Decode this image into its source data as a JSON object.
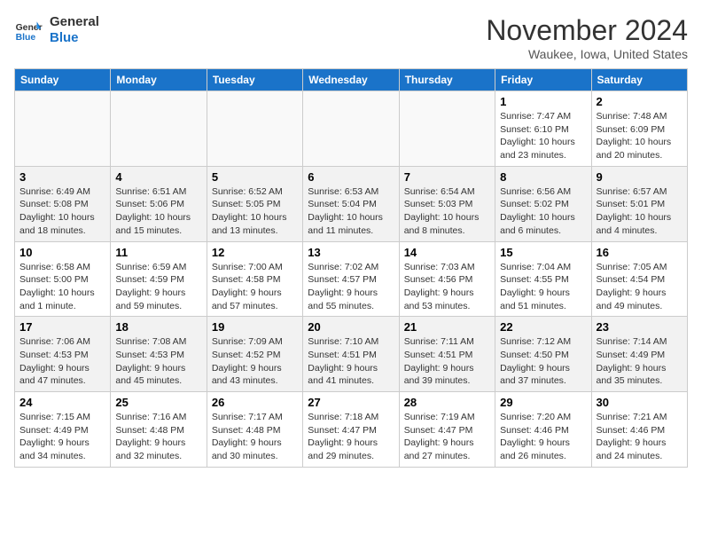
{
  "logo": {
    "line1": "General",
    "line2": "Blue"
  },
  "title": "November 2024",
  "location": "Waukee, Iowa, United States",
  "days_of_week": [
    "Sunday",
    "Monday",
    "Tuesday",
    "Wednesday",
    "Thursday",
    "Friday",
    "Saturday"
  ],
  "weeks": [
    [
      {
        "day": "",
        "info": ""
      },
      {
        "day": "",
        "info": ""
      },
      {
        "day": "",
        "info": ""
      },
      {
        "day": "",
        "info": ""
      },
      {
        "day": "",
        "info": ""
      },
      {
        "day": "1",
        "info": "Sunrise: 7:47 AM\nSunset: 6:10 PM\nDaylight: 10 hours and 23 minutes."
      },
      {
        "day": "2",
        "info": "Sunrise: 7:48 AM\nSunset: 6:09 PM\nDaylight: 10 hours and 20 minutes."
      }
    ],
    [
      {
        "day": "3",
        "info": "Sunrise: 6:49 AM\nSunset: 5:08 PM\nDaylight: 10 hours and 18 minutes."
      },
      {
        "day": "4",
        "info": "Sunrise: 6:51 AM\nSunset: 5:06 PM\nDaylight: 10 hours and 15 minutes."
      },
      {
        "day": "5",
        "info": "Sunrise: 6:52 AM\nSunset: 5:05 PM\nDaylight: 10 hours and 13 minutes."
      },
      {
        "day": "6",
        "info": "Sunrise: 6:53 AM\nSunset: 5:04 PM\nDaylight: 10 hours and 11 minutes."
      },
      {
        "day": "7",
        "info": "Sunrise: 6:54 AM\nSunset: 5:03 PM\nDaylight: 10 hours and 8 minutes."
      },
      {
        "day": "8",
        "info": "Sunrise: 6:56 AM\nSunset: 5:02 PM\nDaylight: 10 hours and 6 minutes."
      },
      {
        "day": "9",
        "info": "Sunrise: 6:57 AM\nSunset: 5:01 PM\nDaylight: 10 hours and 4 minutes."
      }
    ],
    [
      {
        "day": "10",
        "info": "Sunrise: 6:58 AM\nSunset: 5:00 PM\nDaylight: 10 hours and 1 minute."
      },
      {
        "day": "11",
        "info": "Sunrise: 6:59 AM\nSunset: 4:59 PM\nDaylight: 9 hours and 59 minutes."
      },
      {
        "day": "12",
        "info": "Sunrise: 7:00 AM\nSunset: 4:58 PM\nDaylight: 9 hours and 57 minutes."
      },
      {
        "day": "13",
        "info": "Sunrise: 7:02 AM\nSunset: 4:57 PM\nDaylight: 9 hours and 55 minutes."
      },
      {
        "day": "14",
        "info": "Sunrise: 7:03 AM\nSunset: 4:56 PM\nDaylight: 9 hours and 53 minutes."
      },
      {
        "day": "15",
        "info": "Sunrise: 7:04 AM\nSunset: 4:55 PM\nDaylight: 9 hours and 51 minutes."
      },
      {
        "day": "16",
        "info": "Sunrise: 7:05 AM\nSunset: 4:54 PM\nDaylight: 9 hours and 49 minutes."
      }
    ],
    [
      {
        "day": "17",
        "info": "Sunrise: 7:06 AM\nSunset: 4:53 PM\nDaylight: 9 hours and 47 minutes."
      },
      {
        "day": "18",
        "info": "Sunrise: 7:08 AM\nSunset: 4:53 PM\nDaylight: 9 hours and 45 minutes."
      },
      {
        "day": "19",
        "info": "Sunrise: 7:09 AM\nSunset: 4:52 PM\nDaylight: 9 hours and 43 minutes."
      },
      {
        "day": "20",
        "info": "Sunrise: 7:10 AM\nSunset: 4:51 PM\nDaylight: 9 hours and 41 minutes."
      },
      {
        "day": "21",
        "info": "Sunrise: 7:11 AM\nSunset: 4:51 PM\nDaylight: 9 hours and 39 minutes."
      },
      {
        "day": "22",
        "info": "Sunrise: 7:12 AM\nSunset: 4:50 PM\nDaylight: 9 hours and 37 minutes."
      },
      {
        "day": "23",
        "info": "Sunrise: 7:14 AM\nSunset: 4:49 PM\nDaylight: 9 hours and 35 minutes."
      }
    ],
    [
      {
        "day": "24",
        "info": "Sunrise: 7:15 AM\nSunset: 4:49 PM\nDaylight: 9 hours and 34 minutes."
      },
      {
        "day": "25",
        "info": "Sunrise: 7:16 AM\nSunset: 4:48 PM\nDaylight: 9 hours and 32 minutes."
      },
      {
        "day": "26",
        "info": "Sunrise: 7:17 AM\nSunset: 4:48 PM\nDaylight: 9 hours and 30 minutes."
      },
      {
        "day": "27",
        "info": "Sunrise: 7:18 AM\nSunset: 4:47 PM\nDaylight: 9 hours and 29 minutes."
      },
      {
        "day": "28",
        "info": "Sunrise: 7:19 AM\nSunset: 4:47 PM\nDaylight: 9 hours and 27 minutes."
      },
      {
        "day": "29",
        "info": "Sunrise: 7:20 AM\nSunset: 4:46 PM\nDaylight: 9 hours and 26 minutes."
      },
      {
        "day": "30",
        "info": "Sunrise: 7:21 AM\nSunset: 4:46 PM\nDaylight: 9 hours and 24 minutes."
      }
    ]
  ]
}
